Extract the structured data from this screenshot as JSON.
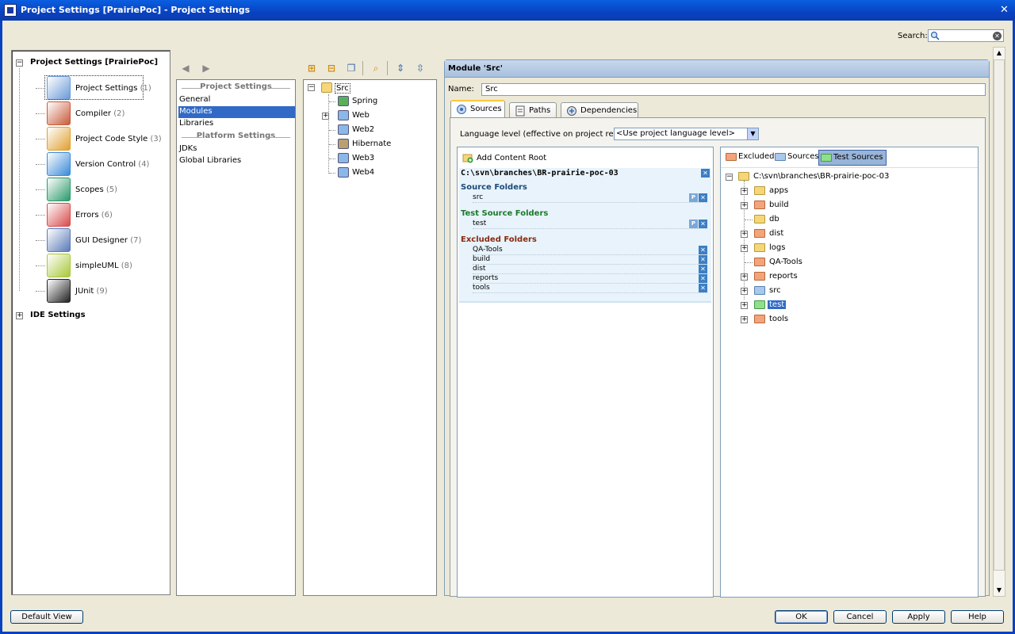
{
  "window": {
    "title": "Project Settings [PrairiePoc] - Project Settings",
    "close_glyph": "✕"
  },
  "search": {
    "label": "Search:",
    "value": ""
  },
  "left_tree": {
    "root": "Project Settings [PrairiePoc]",
    "items": [
      {
        "label": "Project Settings",
        "num": "(1)",
        "icon": "project-settings-icon",
        "color": "#6a9ad8"
      },
      {
        "label": "Compiler",
        "num": "(2)",
        "icon": "compiler-icon",
        "color": "#c85a3a"
      },
      {
        "label": "Project Code Style",
        "num": "(3)",
        "icon": "code-style-icon",
        "color": "#e0a030"
      },
      {
        "label": "Version Control",
        "num": "(4)",
        "icon": "version-control-icon",
        "color": "#3a8ad8"
      },
      {
        "label": "Scopes",
        "num": "(5)",
        "icon": "scopes-icon",
        "color": "#2a9a6a"
      },
      {
        "label": "Errors",
        "num": "(6)",
        "icon": "errors-icon",
        "color": "#d84a4a"
      },
      {
        "label": "GUI Designer",
        "num": "(7)",
        "icon": "gui-designer-icon",
        "color": "#5a7ab8"
      },
      {
        "label": "simpleUML",
        "num": "(8)",
        "icon": "simple-uml-icon",
        "color": "#a8c83a"
      },
      {
        "label": "JUnit",
        "num": "(9)",
        "icon": "junit-icon",
        "color": "#222222"
      }
    ],
    "ide_root": "IDE Settings"
  },
  "middle_list": {
    "project_header": "Project Settings",
    "project_items": [
      "General",
      "Modules",
      "Libraries"
    ],
    "selected": "Modules",
    "platform_header": "Platform Settings",
    "platform_items": [
      "JDKs",
      "Global Libraries"
    ]
  },
  "module_tree": {
    "root": "Src",
    "children": [
      "Spring",
      "Web",
      "Web2",
      "Hibernate",
      "Web3",
      "Web4"
    ]
  },
  "module": {
    "header": "Module 'Src'",
    "name_label": "Name:",
    "name_value": "Src",
    "tabs": [
      "Sources",
      "Paths",
      "Dependencies"
    ],
    "language_label": "Language level (effective on project reload):",
    "language_value": "<Use project language level>",
    "add_content_root": "Add Content Root",
    "content_root_path": "C:\\svn\\branches\\BR-prairie-poc-03",
    "source_folders_title": "Source Folders",
    "source_folders": [
      "src"
    ],
    "test_folders_title": "Test Source Folders",
    "test_folders": [
      "test"
    ],
    "excluded_title": "Excluded Folders",
    "excluded_folders": [
      "QA-Tools",
      "build",
      "dist",
      "reports",
      "tools"
    ],
    "mark_buttons": [
      "Excluded",
      "Sources",
      "Test Sources"
    ],
    "folder_root": "C:\\svn\\branches\\BR-prairie-poc-03",
    "folders": [
      {
        "name": "apps",
        "type": "normal",
        "expandable": true
      },
      {
        "name": "build",
        "type": "excluded",
        "expandable": true
      },
      {
        "name": "db",
        "type": "normal",
        "expandable": false
      },
      {
        "name": "dist",
        "type": "excluded",
        "expandable": true
      },
      {
        "name": "logs",
        "type": "normal",
        "expandable": true
      },
      {
        "name": "QA-Tools",
        "type": "excluded",
        "expandable": false
      },
      {
        "name": "reports",
        "type": "excluded",
        "expandable": true
      },
      {
        "name": "src",
        "type": "source",
        "expandable": true
      },
      {
        "name": "test",
        "type": "test",
        "expandable": true
      },
      {
        "name": "tools",
        "type": "excluded",
        "expandable": true
      }
    ]
  },
  "buttons": {
    "default_view": "Default View",
    "ok": "OK",
    "cancel": "Cancel",
    "apply": "Apply",
    "help": "Help"
  },
  "colors": {
    "source_title": "#1a4a7a",
    "test_title": "#1a7a2a",
    "excluded_title": "#8a2a10",
    "folder_normal": "#f5d77a",
    "folder_excluded": "#f4a47a",
    "folder_source": "#a8c8ec",
    "folder_test": "#8ee08a"
  }
}
